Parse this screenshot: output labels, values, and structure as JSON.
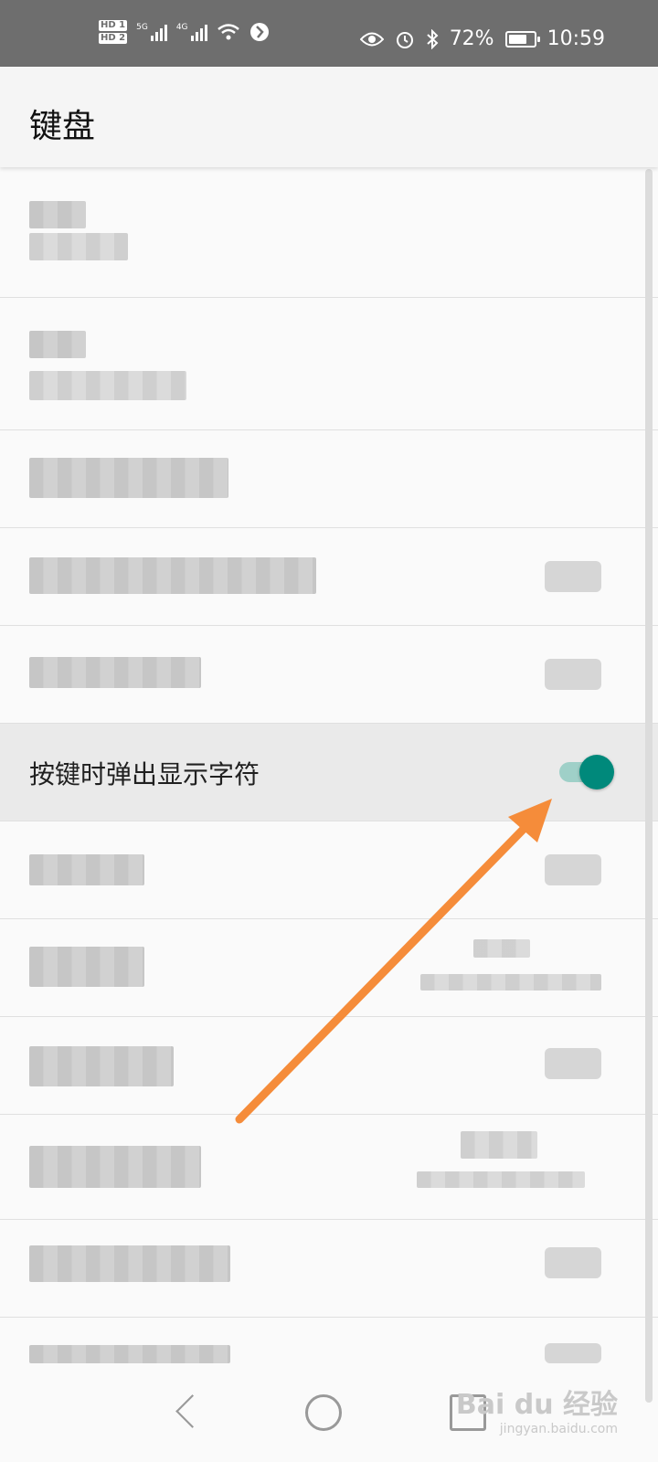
{
  "status_bar": {
    "hd1": "HD 1",
    "hd2": "HD 2",
    "net1": "5G",
    "net2": "4G",
    "battery_percent": "72%",
    "battery_level": 0.72,
    "time": "10:59",
    "icons": [
      "eye-icon",
      "alarm-icon",
      "bluetooth-icon",
      "battery-icon",
      "wifi-icon",
      "vpn-icon"
    ]
  },
  "header": {
    "title": "键盘"
  },
  "settings": {
    "highlighted_label": "按键时弹出显示字符",
    "highlighted_switch_on": true
  },
  "colors": {
    "accent": "#00897b",
    "accent_track": "#9fd0c8",
    "arrow": "#f58c3a"
  },
  "watermark": {
    "brand": "Bai du 经验",
    "domain": "jingyan.baidu.com"
  }
}
